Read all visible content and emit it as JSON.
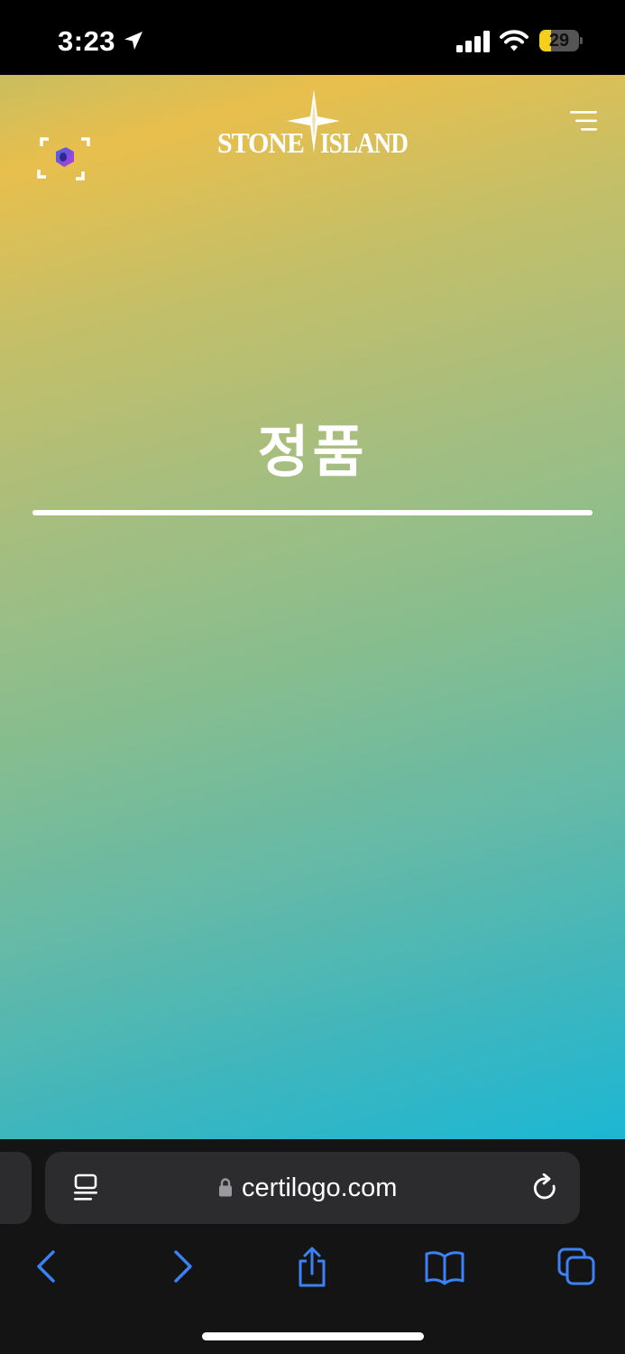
{
  "status_bar": {
    "time": "3:23",
    "battery_level": "29",
    "battery_fraction": 0.29,
    "icons": [
      "location-arrow-icon",
      "cellular-signal-icon",
      "wifi-icon",
      "battery-icon"
    ]
  },
  "page": {
    "brand_logo_text": "STONE ISLAND",
    "title": "정품",
    "icons": [
      "scan-icon",
      "compass-star-icon",
      "hamburger-menu-icon"
    ],
    "colors": {
      "gradient_top": "#e8bf4d",
      "gradient_middle": "#86bd8f",
      "gradient_bottom": "#1cb7d4",
      "text": "#ffffff"
    }
  },
  "browser": {
    "url": "certilogo.com",
    "icons": [
      "reader-view-icon",
      "lock-icon",
      "reload-icon"
    ],
    "toolbar": {
      "icons": [
        "chevron-left-icon",
        "chevron-right-icon",
        "share-icon",
        "bookmarks-icon",
        "tabs-icon"
      ],
      "accent_color": "#3b82f6"
    }
  }
}
